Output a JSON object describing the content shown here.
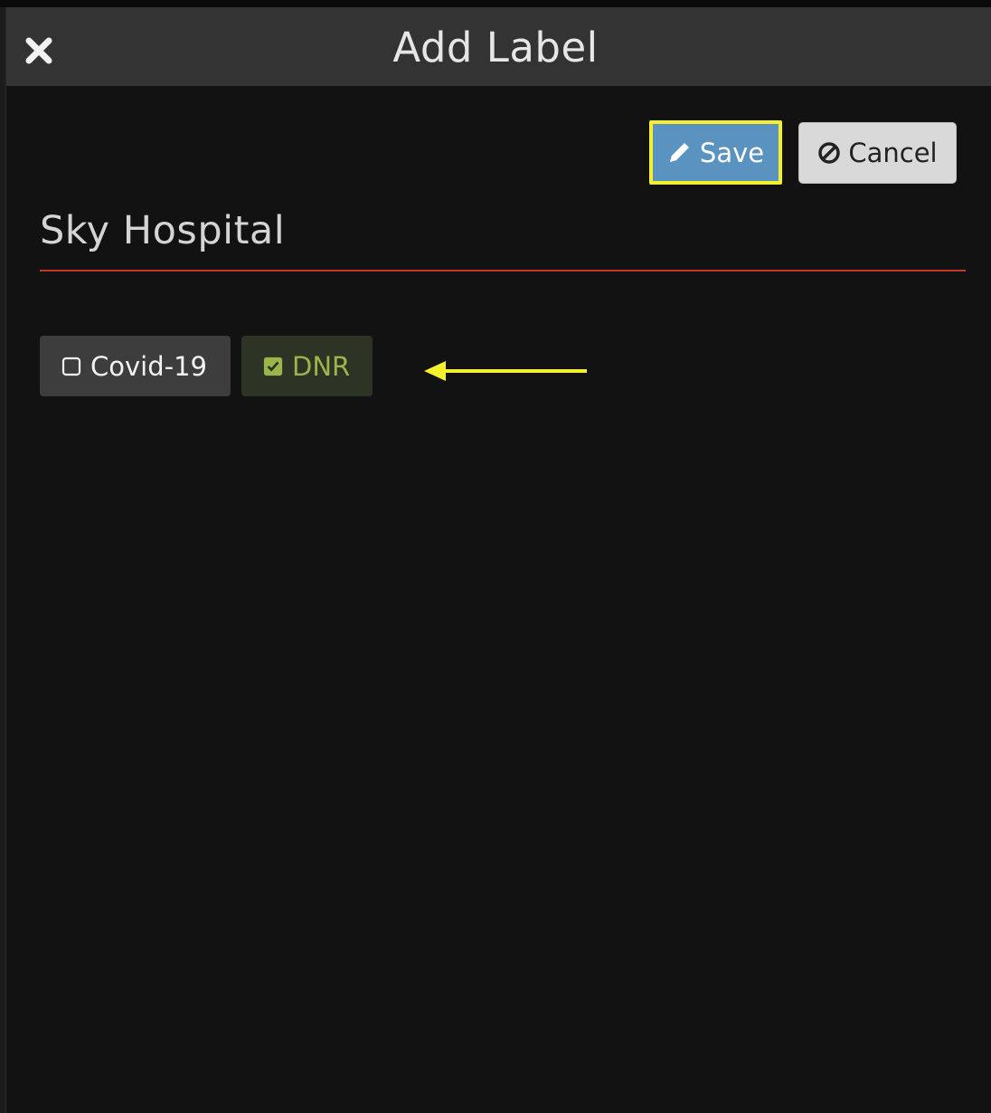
{
  "dialog": {
    "title": "Add Label",
    "close_icon": "close-icon"
  },
  "actions": {
    "save_label": "Save",
    "save_icon": "pencil-icon",
    "cancel_label": "Cancel",
    "cancel_icon": "ban-icon"
  },
  "hospital": {
    "name": "Sky Hospital"
  },
  "labels": [
    {
      "text": "Covid-19",
      "checked": false,
      "icon": "checkbox-empty-icon"
    },
    {
      "text": "DNR",
      "checked": true,
      "icon": "checkbox-checked-icon"
    }
  ],
  "annotation": {
    "icon": "yellow-arrow-left-icon",
    "color": "#f4f02d"
  },
  "colors": {
    "save_button": "#5b93c0",
    "save_highlight": "#f4f02d",
    "divider": "#c0392b",
    "dnr_text": "#9bb54a"
  }
}
